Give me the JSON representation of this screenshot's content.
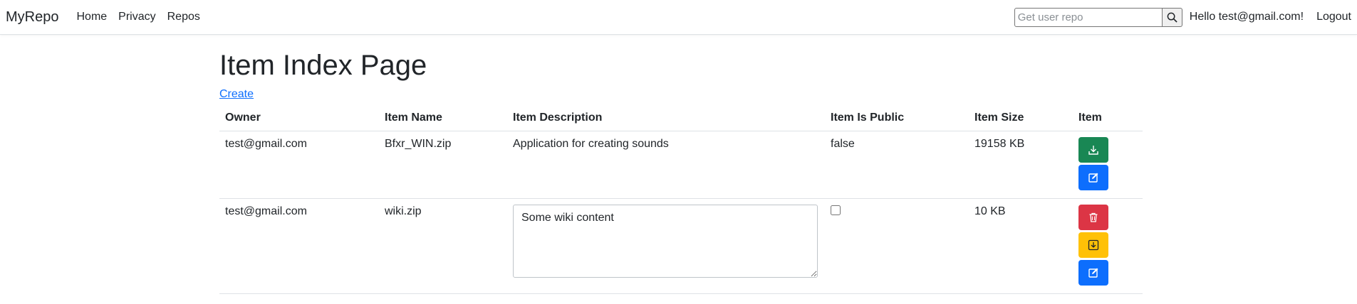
{
  "navbar": {
    "brand": "MyRepo",
    "links": [
      "Home",
      "Privacy",
      "Repos"
    ],
    "search_placeholder": "Get user repo",
    "greeting": "Hello test@gmail.com!",
    "logout": "Logout"
  },
  "page": {
    "title": "Item Index Page",
    "create_link": "Create"
  },
  "table": {
    "headers": [
      "Owner",
      "Item Name",
      "Item Description",
      "Item Is Public",
      "Item Size",
      "Item"
    ],
    "rows": [
      {
        "owner": "test@gmail.com",
        "name": "Bfxr_WIN.zip",
        "description": "Application for creating sounds",
        "is_public": "false",
        "size": "19158 KB"
      },
      {
        "owner": "test@gmail.com",
        "name": "wiki.zip",
        "description": "Some wiki content",
        "is_public_checked": false,
        "size": "10 KB"
      }
    ]
  },
  "colors": {
    "download": "#198754",
    "edit": "#0d6efd",
    "delete": "#dc3545",
    "save": "#ffc107"
  },
  "icons": {
    "search": "search-icon",
    "download": "download-icon",
    "edit": "edit-icon",
    "delete": "trash-icon",
    "save": "save-download-icon"
  }
}
